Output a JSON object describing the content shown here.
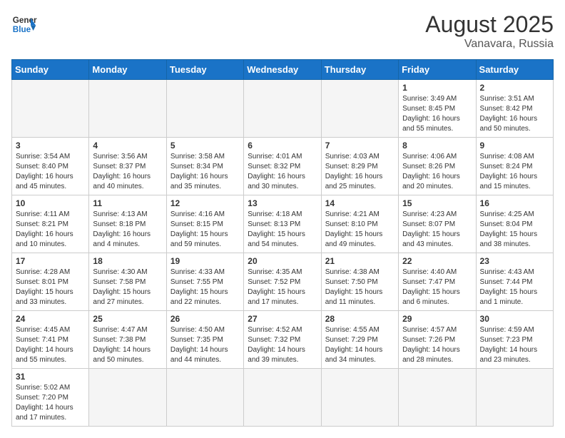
{
  "header": {
    "logo_general": "General",
    "logo_blue": "Blue",
    "title": "August 2025",
    "subtitle": "Vanavara, Russia"
  },
  "days_of_week": [
    "Sunday",
    "Monday",
    "Tuesday",
    "Wednesday",
    "Thursday",
    "Friday",
    "Saturday"
  ],
  "weeks": [
    [
      {
        "day": "",
        "info": ""
      },
      {
        "day": "",
        "info": ""
      },
      {
        "day": "",
        "info": ""
      },
      {
        "day": "",
        "info": ""
      },
      {
        "day": "",
        "info": ""
      },
      {
        "day": "1",
        "info": "Sunrise: 3:49 AM\nSunset: 8:45 PM\nDaylight: 16 hours\nand 55 minutes."
      },
      {
        "day": "2",
        "info": "Sunrise: 3:51 AM\nSunset: 8:42 PM\nDaylight: 16 hours\nand 50 minutes."
      }
    ],
    [
      {
        "day": "3",
        "info": "Sunrise: 3:54 AM\nSunset: 8:40 PM\nDaylight: 16 hours\nand 45 minutes."
      },
      {
        "day": "4",
        "info": "Sunrise: 3:56 AM\nSunset: 8:37 PM\nDaylight: 16 hours\nand 40 minutes."
      },
      {
        "day": "5",
        "info": "Sunrise: 3:58 AM\nSunset: 8:34 PM\nDaylight: 16 hours\nand 35 minutes."
      },
      {
        "day": "6",
        "info": "Sunrise: 4:01 AM\nSunset: 8:32 PM\nDaylight: 16 hours\nand 30 minutes."
      },
      {
        "day": "7",
        "info": "Sunrise: 4:03 AM\nSunset: 8:29 PM\nDaylight: 16 hours\nand 25 minutes."
      },
      {
        "day": "8",
        "info": "Sunrise: 4:06 AM\nSunset: 8:26 PM\nDaylight: 16 hours\nand 20 minutes."
      },
      {
        "day": "9",
        "info": "Sunrise: 4:08 AM\nSunset: 8:24 PM\nDaylight: 16 hours\nand 15 minutes."
      }
    ],
    [
      {
        "day": "10",
        "info": "Sunrise: 4:11 AM\nSunset: 8:21 PM\nDaylight: 16 hours\nand 10 minutes."
      },
      {
        "day": "11",
        "info": "Sunrise: 4:13 AM\nSunset: 8:18 PM\nDaylight: 16 hours\nand 4 minutes."
      },
      {
        "day": "12",
        "info": "Sunrise: 4:16 AM\nSunset: 8:15 PM\nDaylight: 15 hours\nand 59 minutes."
      },
      {
        "day": "13",
        "info": "Sunrise: 4:18 AM\nSunset: 8:13 PM\nDaylight: 15 hours\nand 54 minutes."
      },
      {
        "day": "14",
        "info": "Sunrise: 4:21 AM\nSunset: 8:10 PM\nDaylight: 15 hours\nand 49 minutes."
      },
      {
        "day": "15",
        "info": "Sunrise: 4:23 AM\nSunset: 8:07 PM\nDaylight: 15 hours\nand 43 minutes."
      },
      {
        "day": "16",
        "info": "Sunrise: 4:25 AM\nSunset: 8:04 PM\nDaylight: 15 hours\nand 38 minutes."
      }
    ],
    [
      {
        "day": "17",
        "info": "Sunrise: 4:28 AM\nSunset: 8:01 PM\nDaylight: 15 hours\nand 33 minutes."
      },
      {
        "day": "18",
        "info": "Sunrise: 4:30 AM\nSunset: 7:58 PM\nDaylight: 15 hours\nand 27 minutes."
      },
      {
        "day": "19",
        "info": "Sunrise: 4:33 AM\nSunset: 7:55 PM\nDaylight: 15 hours\nand 22 minutes."
      },
      {
        "day": "20",
        "info": "Sunrise: 4:35 AM\nSunset: 7:52 PM\nDaylight: 15 hours\nand 17 minutes."
      },
      {
        "day": "21",
        "info": "Sunrise: 4:38 AM\nSunset: 7:50 PM\nDaylight: 15 hours\nand 11 minutes."
      },
      {
        "day": "22",
        "info": "Sunrise: 4:40 AM\nSunset: 7:47 PM\nDaylight: 15 hours\nand 6 minutes."
      },
      {
        "day": "23",
        "info": "Sunrise: 4:43 AM\nSunset: 7:44 PM\nDaylight: 15 hours\nand 1 minute."
      }
    ],
    [
      {
        "day": "24",
        "info": "Sunrise: 4:45 AM\nSunset: 7:41 PM\nDaylight: 14 hours\nand 55 minutes."
      },
      {
        "day": "25",
        "info": "Sunrise: 4:47 AM\nSunset: 7:38 PM\nDaylight: 14 hours\nand 50 minutes."
      },
      {
        "day": "26",
        "info": "Sunrise: 4:50 AM\nSunset: 7:35 PM\nDaylight: 14 hours\nand 44 minutes."
      },
      {
        "day": "27",
        "info": "Sunrise: 4:52 AM\nSunset: 7:32 PM\nDaylight: 14 hours\nand 39 minutes."
      },
      {
        "day": "28",
        "info": "Sunrise: 4:55 AM\nSunset: 7:29 PM\nDaylight: 14 hours\nand 34 minutes."
      },
      {
        "day": "29",
        "info": "Sunrise: 4:57 AM\nSunset: 7:26 PM\nDaylight: 14 hours\nand 28 minutes."
      },
      {
        "day": "30",
        "info": "Sunrise: 4:59 AM\nSunset: 7:23 PM\nDaylight: 14 hours\nand 23 minutes."
      }
    ],
    [
      {
        "day": "31",
        "info": "Sunrise: 5:02 AM\nSunset: 7:20 PM\nDaylight: 14 hours\nand 17 minutes."
      },
      {
        "day": "",
        "info": ""
      },
      {
        "day": "",
        "info": ""
      },
      {
        "day": "",
        "info": ""
      },
      {
        "day": "",
        "info": ""
      },
      {
        "day": "",
        "info": ""
      },
      {
        "day": "",
        "info": ""
      }
    ]
  ]
}
